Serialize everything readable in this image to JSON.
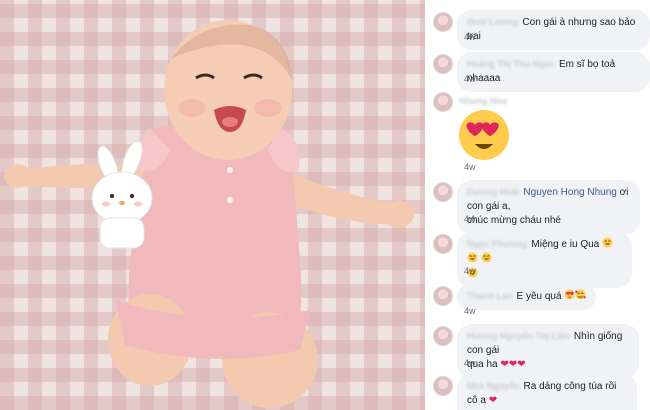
{
  "comments": [
    {
      "name": "Hoài Lương",
      "text": "Con gái à nhưng sao bảo trai",
      "time": "4w"
    },
    {
      "name": "Hoàng Thị Thu Ngọc",
      "text": "Em sĩ bọ toả nhaaaa",
      "time": "4w"
    },
    {
      "name": "Nhung Hoa",
      "emoji": "heart-eyes-emoji",
      "time": "4w"
    },
    {
      "name": "Dương Hoài",
      "mention": "Nguyen Hong Nhung",
      "text_line1": " ơi con gái a,",
      "text_line2": "chúc mừng cháu nhé",
      "time": "4w"
    },
    {
      "name": "Ngọc Phương",
      "text": "Miệng e iu Qua",
      "emoji_count": 4,
      "time": "4w"
    },
    {
      "name": "Thanh Lan",
      "text": "E yêu quá",
      "time": "4w"
    },
    {
      "name": "Hương Nguyễn Thị Liên",
      "text_line1": "Nhìn giống con gái",
      "text_line2": "qua ha",
      "heart_count": 3,
      "time": "4w"
    },
    {
      "name": "Nhà Nguyễn",
      "text": "Ra dáng công túa rồi cô a",
      "heart_count": 3
    }
  ],
  "colors": {
    "bubble": "#f0f2f5",
    "mention": "#385898",
    "heart": "#e0245e"
  },
  "photo": {
    "subject": "baby-on-gingham-blanket",
    "toy": "bunny-lamp"
  }
}
